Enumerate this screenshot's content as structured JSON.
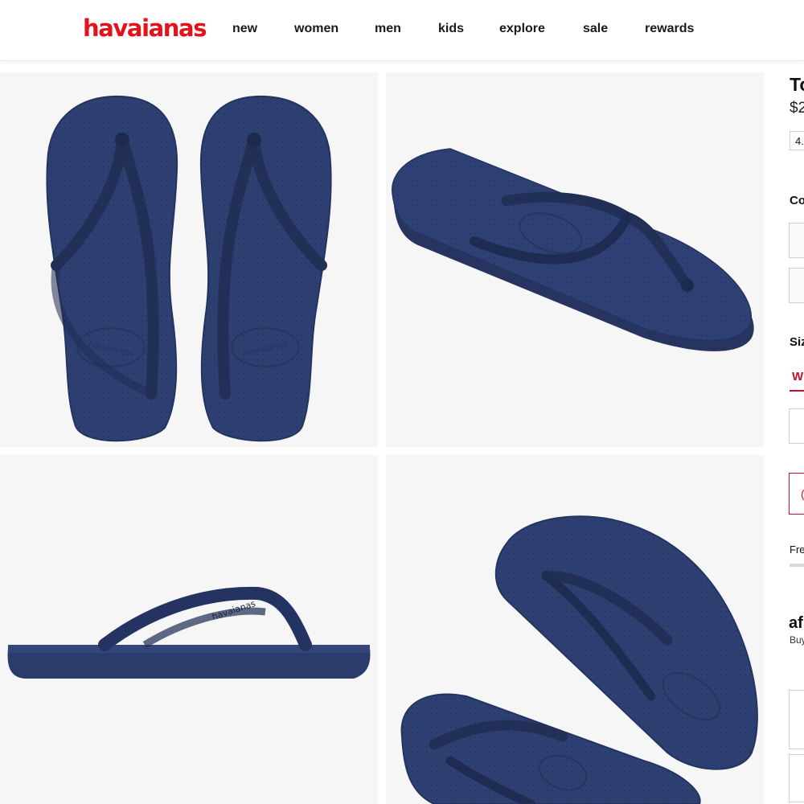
{
  "header": {
    "logo_text": "havaianas",
    "nav": [
      "new",
      "women",
      "men",
      "kids",
      "explore",
      "sale",
      "rewards"
    ]
  },
  "gallery": {
    "product_color": "#2e3f72",
    "images": [
      "top-view-pair",
      "angled-single",
      "side-profile",
      "overlapping-pair"
    ]
  },
  "panel": {
    "title": "To",
    "price": "$2",
    "rating": "4.",
    "color_label": "Co",
    "size_label": "Siz",
    "size_tab": "W",
    "cta": "(",
    "free_shipping": "Fre",
    "afterpay": "af",
    "buy": "Buy"
  },
  "colors": {
    "brand": "#e4131b",
    "accent": "#c8102e"
  }
}
